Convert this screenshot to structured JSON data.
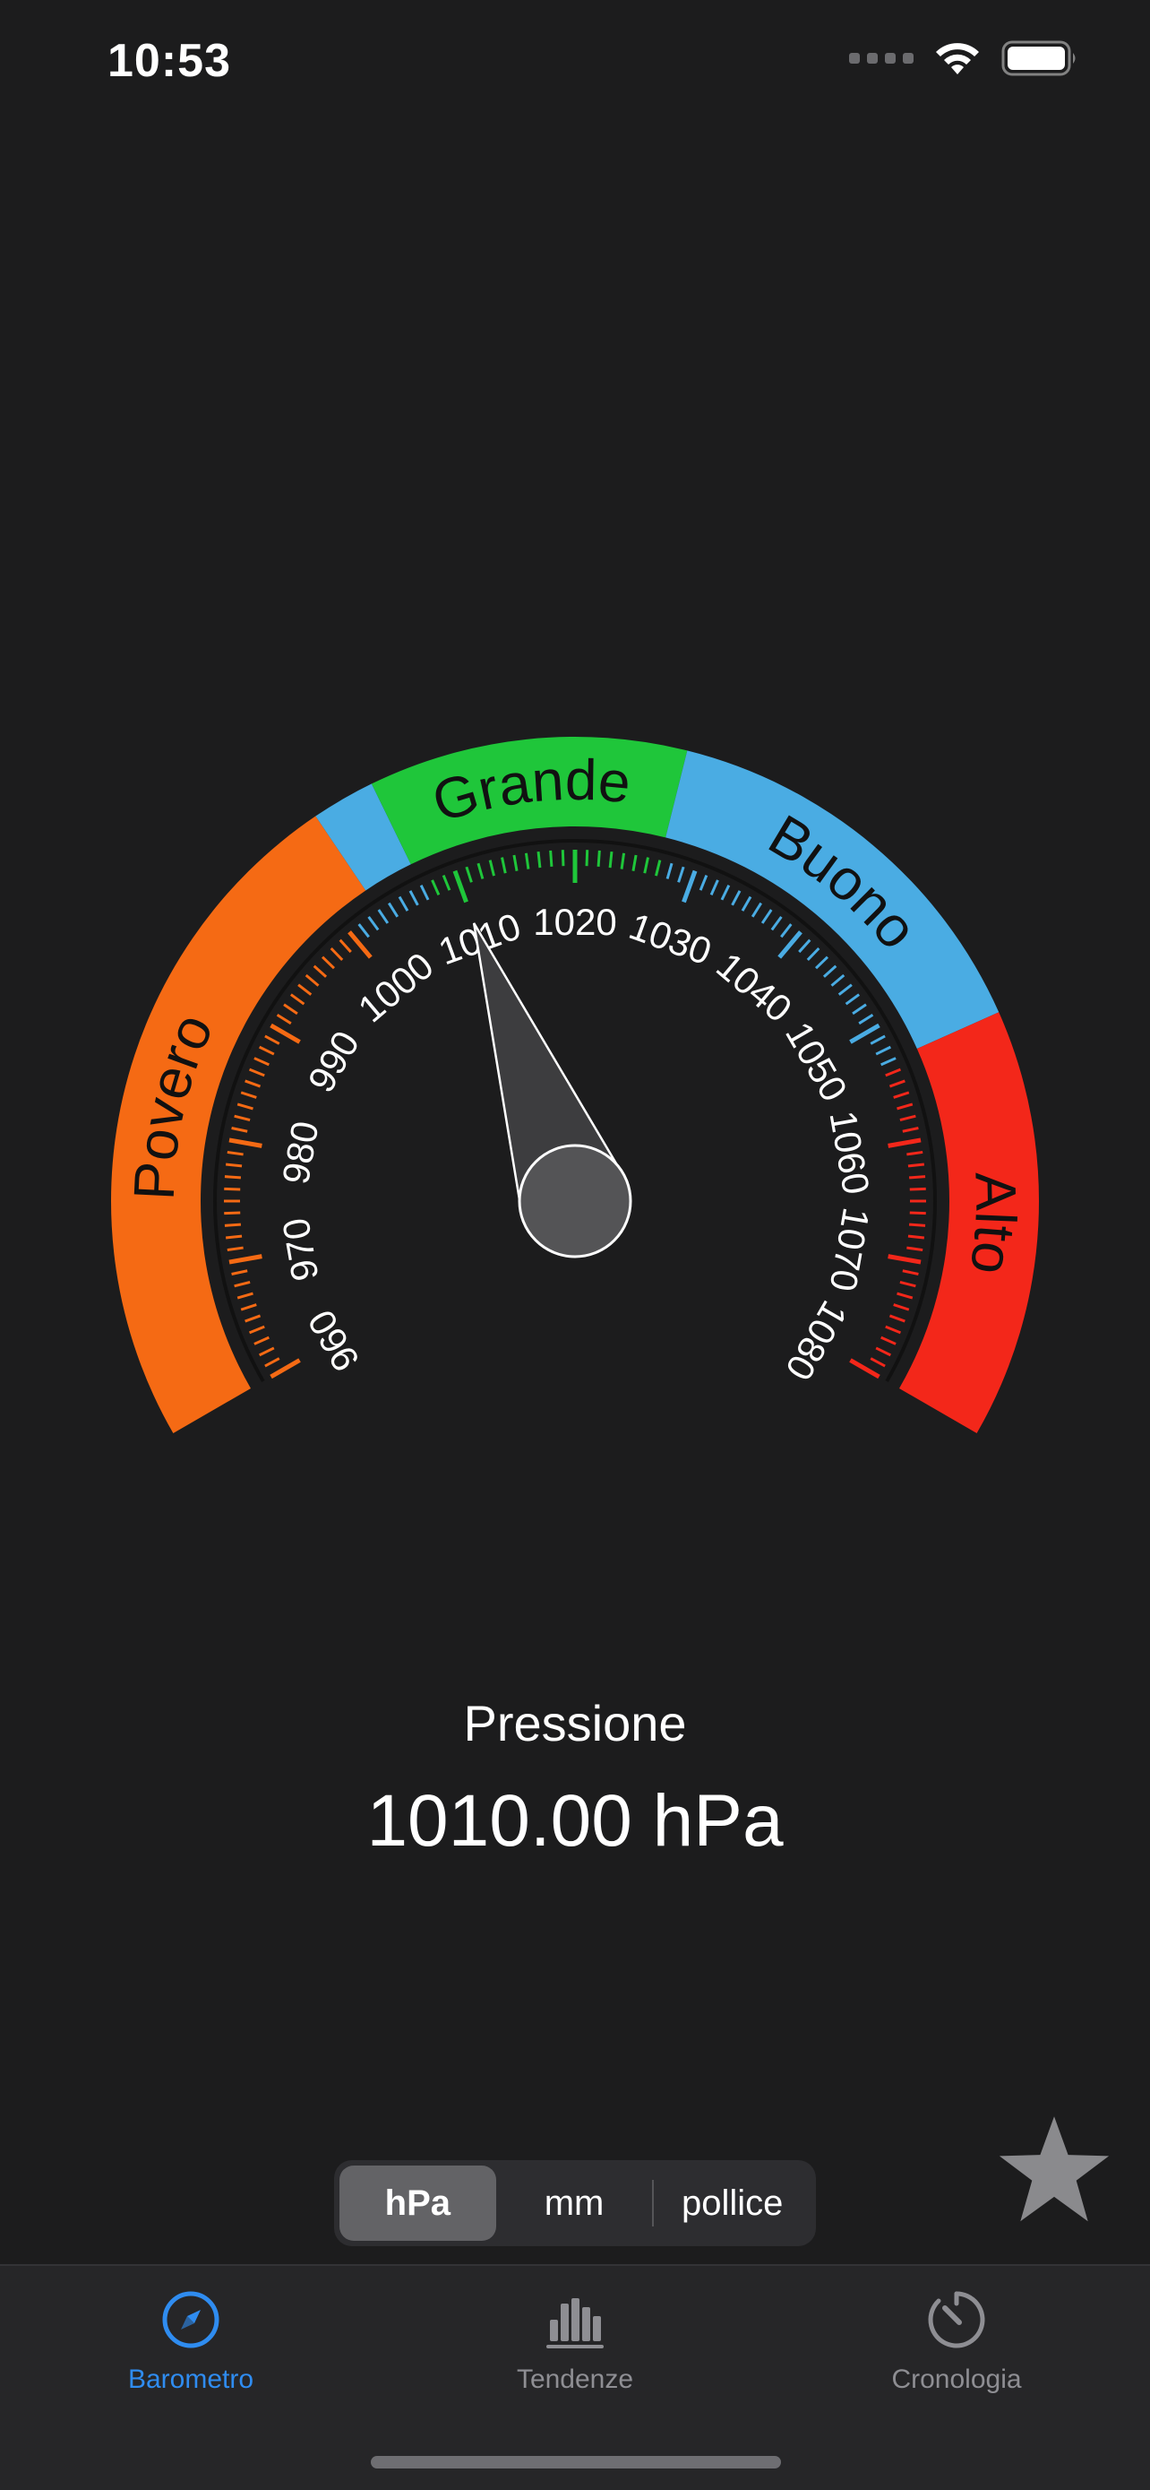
{
  "status_bar": {
    "time": "10:53"
  },
  "gauge": {
    "unit": "hPa",
    "min": 960,
    "max": 1080,
    "value": 1010,
    "start_angle_deg": 210,
    "end_angle_deg": -30,
    "tick_labels": [
      "960",
      "970",
      "980",
      "990",
      "1000",
      "1010",
      "1020",
      "1030",
      "1040",
      "1050",
      "1060",
      "1070",
      "1080"
    ],
    "zones": [
      {
        "name": "Povero",
        "from": 960,
        "to": 1003,
        "color": "#f56a14"
      },
      {
        "name": "",
        "from": 1003,
        "to": 1007,
        "color": "#4aace3"
      },
      {
        "name": "Grande",
        "from": 1007,
        "to": 1027,
        "color": "#1fc63a"
      },
      {
        "name": "Buono",
        "from": 1027,
        "to": 1053,
        "color": "#4aace3"
      },
      {
        "name": "Alto",
        "from": 1053,
        "to": 1080,
        "color": "#f3271a"
      }
    ],
    "scale_colors": [
      {
        "from": 960,
        "to": 1000,
        "color": "#f56a14"
      },
      {
        "from": 1000,
        "to": 1007,
        "color": "#4aace3"
      },
      {
        "from": 1007,
        "to": 1027,
        "color": "#1fc63a"
      },
      {
        "from": 1027,
        "to": 1053,
        "color": "#4aace3"
      },
      {
        "from": 1053,
        "to": 1080,
        "color": "#f3271a"
      }
    ]
  },
  "reading": {
    "label": "Pressione",
    "value": "1010.00 hPa"
  },
  "units": {
    "options": [
      "hPa",
      "mm",
      "pollice"
    ],
    "selected": "hPa"
  },
  "favorite_icon": "star-icon",
  "tabs": [
    {
      "label": "Barometro",
      "icon": "compass-icon",
      "active": true
    },
    {
      "label": "Tendenze",
      "icon": "bar-chart-icon",
      "active": false
    },
    {
      "label": "Cronologia",
      "icon": "timer-icon",
      "active": false
    }
  ],
  "colors": {
    "accent": "#2f8cf0",
    "background": "#1c1c1d",
    "tab_bar": "#262628"
  }
}
